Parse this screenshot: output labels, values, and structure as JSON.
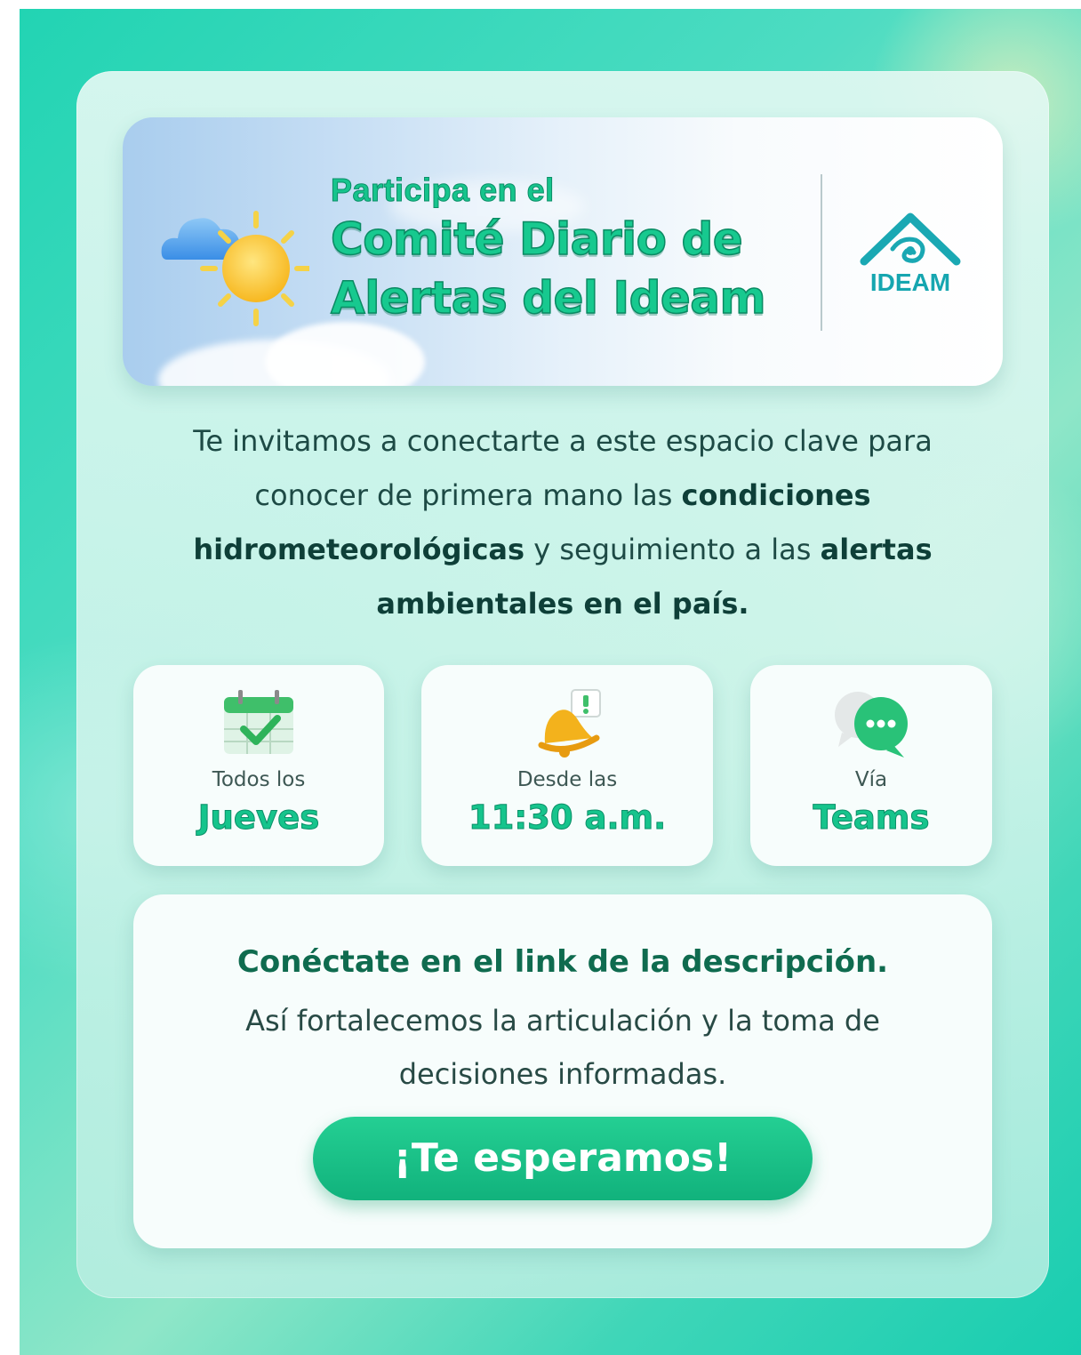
{
  "banner": {
    "pretitle": "Participa en el",
    "title_line1": "Comité Diario de",
    "title_line2": "Alertas del Ideam",
    "logo_text": "IDEAM"
  },
  "intro": {
    "part1": "Te invitamos a conectarte a este espacio clave para conocer de primera mano las ",
    "bold1": "condiciones hidrometeorológicas",
    "part2": " y seguimiento a las ",
    "bold2": "alertas ambientales en el país."
  },
  "info_cards": [
    {
      "icon": "calendar-icon",
      "label": "Todos los",
      "value": "Jueves"
    },
    {
      "icon": "bell-icon",
      "label": "Desde las",
      "value": "11:30 a.m."
    },
    {
      "icon": "chat-icon",
      "label": "Vía",
      "value": "Teams"
    }
  ],
  "cta": {
    "title": "Conéctate en el link de la descripción.",
    "body": "Así fortalecemos la articulación y la toma de decisiones informadas.",
    "button_label": "¡Te esperamos!"
  },
  "colors": {
    "accent_green": "#16c48c",
    "dark_green": "#0f6b4f",
    "teal_logo": "#16a6b0",
    "background_teal": "#22d4b3"
  }
}
